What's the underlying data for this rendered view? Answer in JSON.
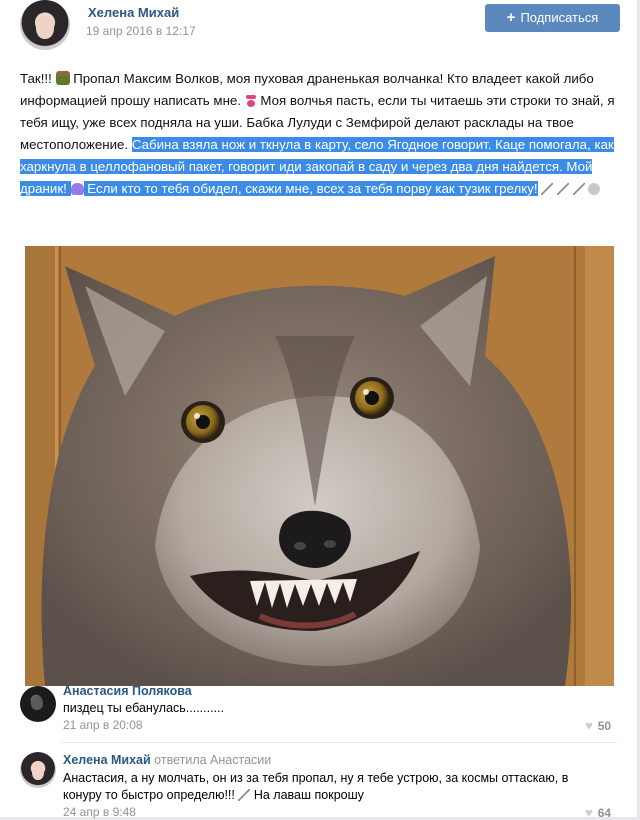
{
  "post": {
    "author": "Хелена Михай",
    "date": "19 апр 2016 в 12:17",
    "subscribe_label": "Подписаться",
    "text": {
      "p1": "Так!!!",
      "p2": " Пропал Максим Волков, моя пуховая драненькая волчанка! Кто владеет какой либо информацией прошу написать мне.",
      "p3": " Моя волчья пасть, если ты читаешь эти строки то знай, я тебя ищу, уже всех подняла на уши. Бабка Лулуди с Земфирой делают расклады на твое местоположение.",
      "hl1": "Сабина взяла нож и ткнула в карту, село Ягодное говорит. Каце помогала, как харкнула в целлофановый пакет, говорит иди закопай в саду и через два дня найдется. Мой драник!",
      "hl2": "Если кто то тебя обидел, скажи мне, всех за тебя порву как тузик грелку!"
    }
  },
  "comments": [
    {
      "name": "Анастасия Полякова",
      "reply_to": "",
      "text": "пиздец ты ебанулась...........",
      "date": "21 апр в 20:08",
      "likes": "50"
    },
    {
      "name": "Хелена Михай",
      "reply_to": "ответила Анастасии",
      "text": "Анастасия, а ну молчать, он из за тебя пропал, ну я тебе устрою, за космы оттаскаю, в конуру то быстро определю!!!",
      "text_end": " На лаваш покрошу",
      "date": "24 апр в 9:48",
      "likes": "64"
    }
  ],
  "icons": {
    "like": "heart-icon",
    "subscribe": "plus-icon"
  },
  "colors": {
    "link": "#2a5885",
    "button": "#5b88bd",
    "selection": "#3c8ce6",
    "muted": "#939393"
  }
}
